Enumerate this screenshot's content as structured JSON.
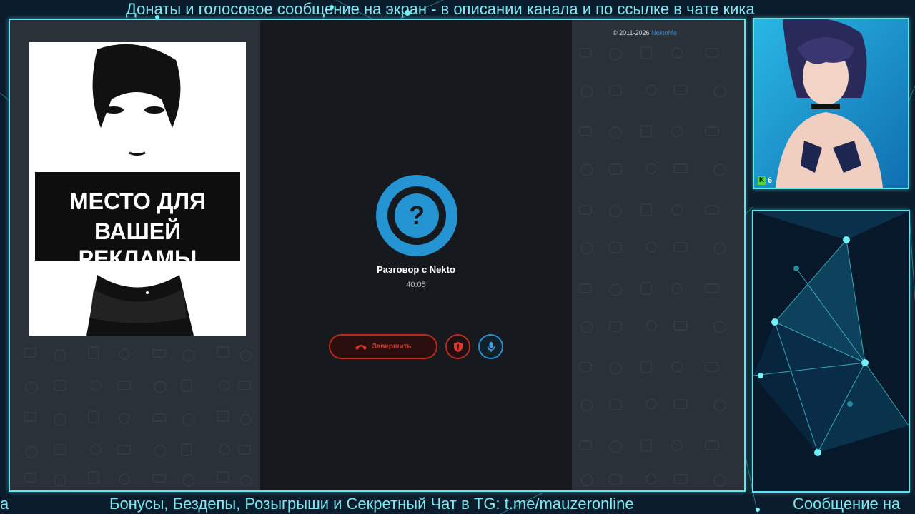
{
  "ticker_top": "Донаты и голосовое сообщение на экран - в описании канала и по ссылке в чате кика",
  "ticker_bottom": {
    "left": "а",
    "middle": "Бонусы, Бездепы, Розыгрыши и Секретный Чат в TG: t.me/mauzeronline",
    "right": "Сообщение на"
  },
  "site": {
    "copyright": "© 2011-2026",
    "brand_link": "NektoMe"
  },
  "ad": {
    "line1": "МЕСТО ДЛЯ",
    "line2": "ВАШЕЙ РЕКЛАМЫ"
  },
  "call": {
    "icon_symbol": "?",
    "title": "Разговор с Nekto",
    "timer": "40:05",
    "end_button_label": "Завершить"
  },
  "webcam": {
    "badge_letter": "K",
    "badge_count": "6"
  },
  "colors": {
    "accent_cyan": "#5ee6ee",
    "call_blue": "#2494d2",
    "end_red": "#c0281e"
  },
  "icons": [
    "phone-hangup-icon",
    "shield-icon",
    "microphone-icon",
    "question-icon"
  ]
}
